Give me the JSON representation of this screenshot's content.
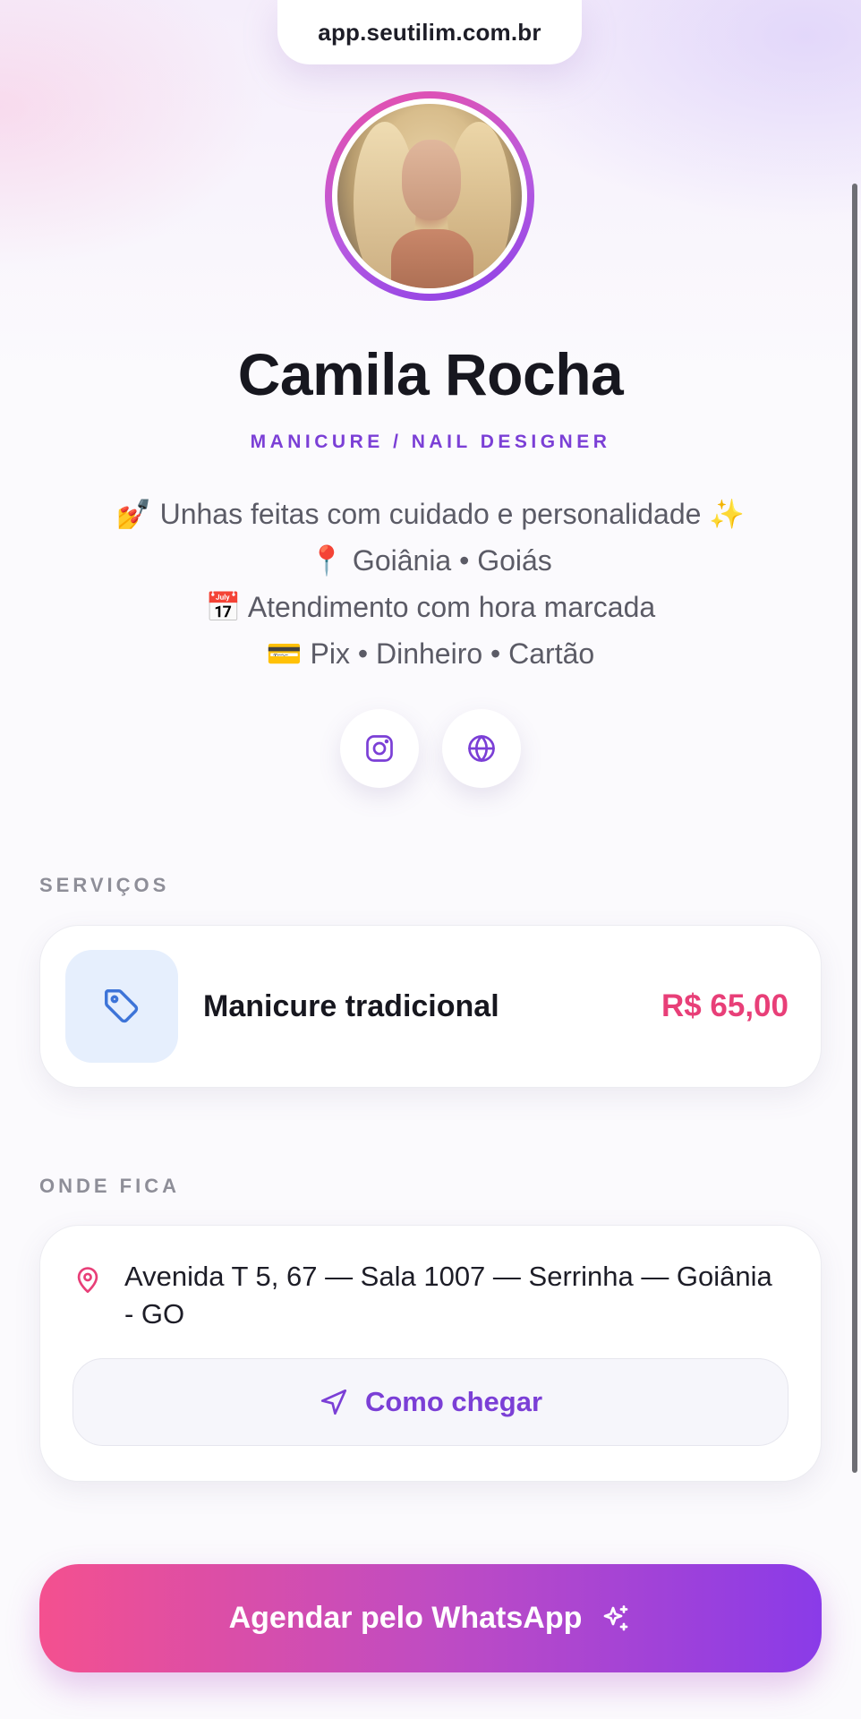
{
  "browser": {
    "url": "app.seutilim.com.br"
  },
  "profile": {
    "name": "Camila Rocha",
    "role": "MANICURE / NAIL DESIGNER",
    "bio": [
      "💅 Unhas feitas com cuidado e personalidade ✨",
      "📍 Goiânia • Goiás",
      "📅 Atendimento com hora marcada",
      "💳 Pix • Dinheiro • Cartão"
    ],
    "social_icons": [
      "instagram-icon",
      "globe-icon"
    ]
  },
  "services": {
    "label": "SERVIÇOS",
    "items": [
      {
        "name": "Manicure tradicional",
        "price": "R$ 65,00",
        "icon": "tag-icon"
      }
    ]
  },
  "location": {
    "label": "ONDE FICA",
    "address": "Avenida T 5, 67 — Sala 1007 — Serrinha — Goiânia - GO",
    "directions_label": "Como chegar"
  },
  "cta": {
    "label": "Agendar pelo WhatsApp",
    "icon": "sparkles-icon"
  },
  "colors": {
    "accent_purple": "#7b3fd6",
    "price_pink": "#e83f78",
    "gradient_start": "#f4508f",
    "gradient_end": "#8a3be8"
  }
}
